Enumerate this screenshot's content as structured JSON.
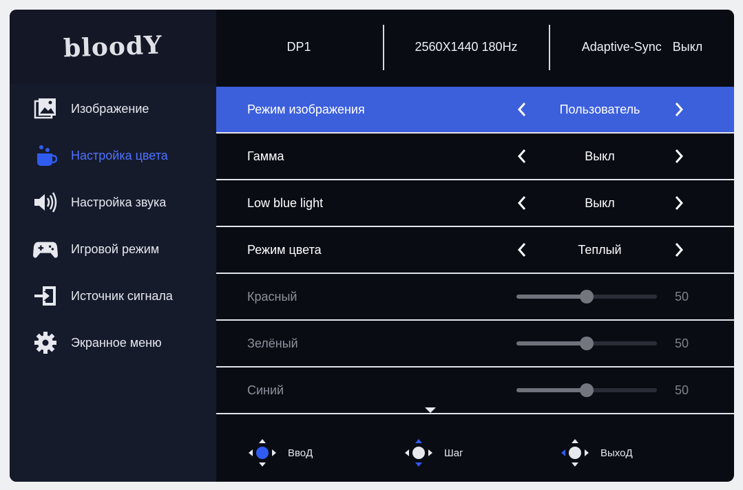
{
  "brand": "bloodY",
  "header": {
    "input": "DP1",
    "resolution": "2560X1440 180Hz",
    "adaptive_sync_label": "Adaptive-Sync",
    "adaptive_sync_value": "Выкл"
  },
  "sidebar": {
    "items": [
      {
        "label": "Изображение",
        "icon": "image-icon"
      },
      {
        "label": "Настройка цвета",
        "icon": "color-cup-icon",
        "active": true
      },
      {
        "label": "Настройка звука",
        "icon": "speaker-icon"
      },
      {
        "label": "Игровой режим",
        "icon": "gamepad-icon"
      },
      {
        "label": "Источник сигнала",
        "icon": "input-source-icon"
      },
      {
        "label": "Экранное меню",
        "icon": "gear-icon"
      }
    ]
  },
  "settings": [
    {
      "label": "Режим изображения",
      "type": "select",
      "value": "Пользователь",
      "selected": true
    },
    {
      "label": "Гамма",
      "type": "select",
      "value": "Выкл"
    },
    {
      "label": "Low blue light",
      "type": "select",
      "value": "Выкл"
    },
    {
      "label": "Режим цвета",
      "type": "select",
      "value": "Теплый"
    },
    {
      "label": "Красный",
      "type": "slider",
      "value": "50",
      "level": 0.5
    },
    {
      "label": "Зелёный",
      "type": "slider",
      "value": "50",
      "level": 0.5
    },
    {
      "label": "Синий",
      "type": "slider",
      "value": "50",
      "level": 0.5
    }
  ],
  "footer": {
    "enter_label": "ВвоД",
    "step_label": "Шаг",
    "exit_label": "ВыхоД"
  },
  "colors": {
    "accent": "#3c5fdc",
    "active_text": "#4f72ff",
    "control_blue": "#2f5cf0"
  }
}
